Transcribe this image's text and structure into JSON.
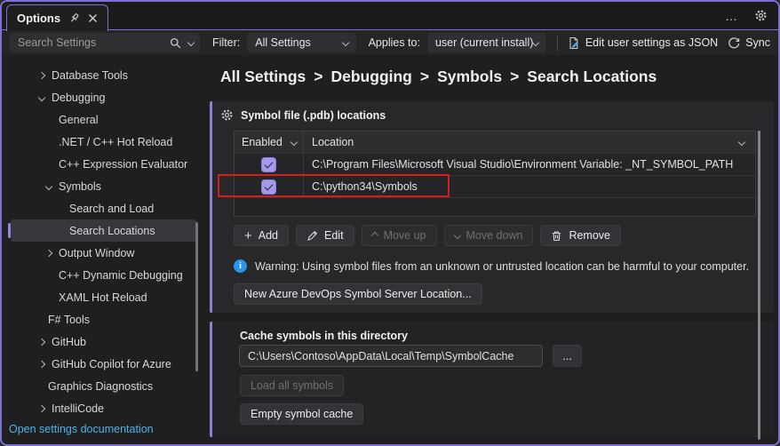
{
  "window": {
    "tab_title": "Options",
    "more_label": "…"
  },
  "toolbar": {
    "search_placeholder": "Search Settings",
    "filter_label": "Filter:",
    "filter_value": "All Settings",
    "applies_label": "Applies to:",
    "applies_value": "user (current install)",
    "edit_json_label": "Edit user settings as JSON",
    "sync_label": "Sync"
  },
  "sidebar": {
    "items": [
      {
        "label": "Database Tools",
        "chevron": "right",
        "level": 1
      },
      {
        "label": "Debugging",
        "chevron": "down",
        "level": 1
      },
      {
        "label": "General",
        "chevron": null,
        "level": 2
      },
      {
        "label": ".NET / C++ Hot Reload",
        "chevron": null,
        "level": 2
      },
      {
        "label": "C++ Expression Evaluator",
        "chevron": null,
        "level": 2
      },
      {
        "label": "Symbols",
        "chevron": "down",
        "level": 2
      },
      {
        "label": "Search and Load",
        "chevron": null,
        "level": 3
      },
      {
        "label": "Search Locations",
        "chevron": null,
        "level": 3,
        "selected": true
      },
      {
        "label": "Output Window",
        "chevron": "right",
        "level": 2
      },
      {
        "label": "C++ Dynamic Debugging",
        "chevron": null,
        "level": 2
      },
      {
        "label": "XAML Hot Reload",
        "chevron": null,
        "level": 2
      },
      {
        "label": "F# Tools",
        "chevron": null,
        "level": 1
      },
      {
        "label": "GitHub",
        "chevron": "right",
        "level": 1
      },
      {
        "label": "GitHub Copilot for Azure",
        "chevron": "right",
        "level": 1
      },
      {
        "label": "Graphics Diagnostics",
        "chevron": null,
        "level": 1
      },
      {
        "label": "IntelliCode",
        "chevron": "right",
        "level": 1
      }
    ],
    "doc_link": "Open settings documentation"
  },
  "main": {
    "breadcrumb": [
      "All Settings",
      "Debugging",
      "Symbols",
      "Search Locations"
    ],
    "breadcrumb_separator": ">",
    "symbol_section": {
      "title": "Symbol file (.pdb) locations",
      "table": {
        "col_enabled": "Enabled",
        "col_location": "Location",
        "rows": [
          {
            "enabled": true,
            "location": "C:\\Program Files\\Microsoft Visual Studio\\Environment Variable: _NT_SYMBOL_PATH"
          },
          {
            "enabled": true,
            "location": "C:\\python34\\Symbols",
            "highlighted": true
          }
        ]
      },
      "buttons": {
        "add": "Add",
        "edit": "Edit",
        "move_up": "Move up",
        "move_down": "Move down",
        "remove": "Remove"
      },
      "warning": "Warning: Using symbol files from an unknown or untrusted location can be harmful to your computer.",
      "azure_button": "New Azure DevOps Symbol Server Location..."
    },
    "cache_section": {
      "label": "Cache symbols in this directory",
      "path": "C:\\Users\\Contoso\\AppData\\Local\\Temp\\SymbolCache",
      "browse_label": "...",
      "load_button": "Load all symbols",
      "empty_button": "Empty symbol cache"
    }
  },
  "icons": {
    "plus": "+",
    "info_glyph": "i"
  },
  "colors": {
    "accent_border": "#7b70d4",
    "annotation_red": "#cf2020",
    "checkbox_purple": "#a49aec",
    "selection_pill": "#9085e2",
    "link_blue": "#4db2e8",
    "info_blue": "#2795e9"
  }
}
